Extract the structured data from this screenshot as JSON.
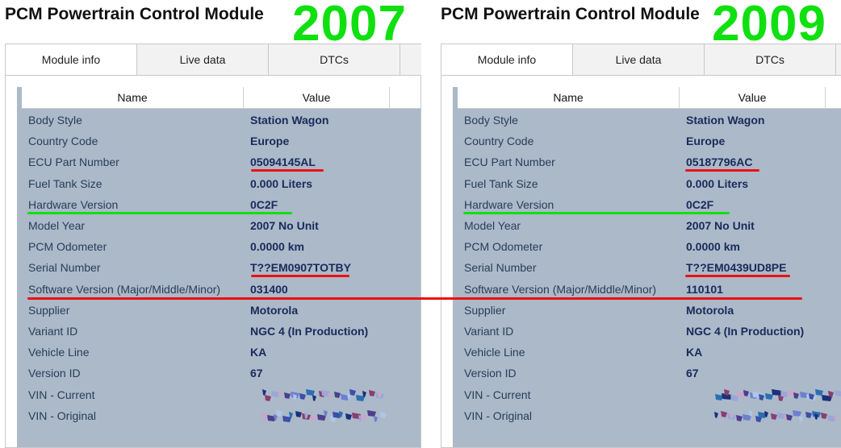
{
  "panels": [
    {
      "title": "PCM Powertrain Control Module",
      "year": "2007",
      "tabs": [
        "Module info",
        "Live data",
        "DTCs",
        ""
      ],
      "columns": {
        "name": "Name",
        "value": "Value"
      },
      "rows": [
        {
          "name": "Body Style",
          "value": "Station Wagon"
        },
        {
          "name": "Country Code",
          "value": "Europe"
        },
        {
          "name": "ECU Part Number",
          "value": "05094145AL"
        },
        {
          "name": "Fuel Tank Size",
          "value": "0.000 Liters"
        },
        {
          "name": "Hardware Version",
          "value": "0C2F"
        },
        {
          "name": "Model Year",
          "value": "2007 No Unit"
        },
        {
          "name": "PCM Odometer",
          "value": "0.0000 km"
        },
        {
          "name": "Serial Number",
          "value": "T??EM0907TOTBY"
        },
        {
          "name": "Software Version (Major/Middle/Minor)",
          "value": "031400"
        },
        {
          "name": "Supplier",
          "value": "Motorola"
        },
        {
          "name": "Variant ID",
          "value": "NGC 4 (In Production)"
        },
        {
          "name": "Vehicle Line",
          "value": "KA"
        },
        {
          "name": "Version ID",
          "value": "67"
        },
        {
          "name": "VIN - Current",
          "value": ""
        },
        {
          "name": "VIN - Original",
          "value": ""
        }
      ]
    },
    {
      "title": "PCM Powertrain Control Module",
      "year": "2009",
      "tabs": [
        "Module info",
        "Live data",
        "DTCs",
        ""
      ],
      "columns": {
        "name": "Name",
        "value": "Value"
      },
      "rows": [
        {
          "name": "Body Style",
          "value": "Station Wagon"
        },
        {
          "name": "Country Code",
          "value": "Europe"
        },
        {
          "name": "ECU Part Number",
          "value": "05187796AC"
        },
        {
          "name": "Fuel Tank Size",
          "value": "0.000 Liters"
        },
        {
          "name": "Hardware Version",
          "value": "0C2F"
        },
        {
          "name": "Model Year",
          "value": "2007 No Unit"
        },
        {
          "name": "PCM Odometer",
          "value": "0.0000 km"
        },
        {
          "name": "Serial Number",
          "value": "T??EM0439UD8PE"
        },
        {
          "name": "Software Version (Major/Middle/Minor)",
          "value": "110101"
        },
        {
          "name": "Supplier",
          "value": "Motorola"
        },
        {
          "name": "Variant ID",
          "value": "NGC 4 (In Production)"
        },
        {
          "name": "Vehicle Line",
          "value": "KA"
        },
        {
          "name": "Version ID",
          "value": "67"
        },
        {
          "name": "VIN - Current",
          "value": ""
        },
        {
          "name": "VIN - Original",
          "value": ""
        }
      ]
    }
  ],
  "colors": {
    "highlight_red": "#ee1010",
    "highlight_green": "#10e010",
    "year_green": "#10e010",
    "grid_bg": "#abb9c9"
  }
}
